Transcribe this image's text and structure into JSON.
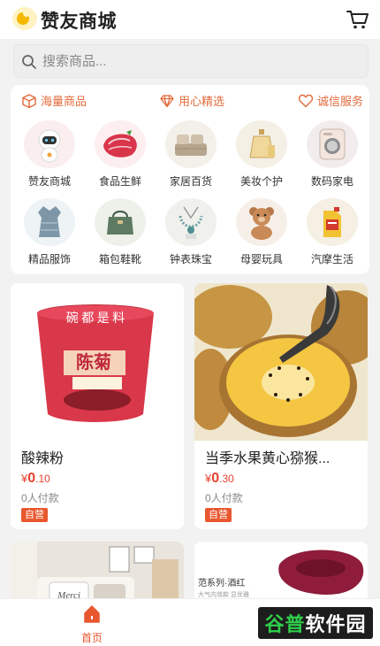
{
  "header": {
    "title": "赞友商城",
    "logo_icon": "banana-logo-icon",
    "cart_icon": "cart-icon"
  },
  "search": {
    "placeholder": "搜索商品..."
  },
  "features": [
    {
      "label": "海量商品",
      "icon": "box-icon"
    },
    {
      "label": "用心精选",
      "icon": "diamond-icon"
    },
    {
      "label": "诚信服务",
      "icon": "heart-icon"
    }
  ],
  "categories": [
    {
      "label": "赞友商城",
      "icon": "robot-icon"
    },
    {
      "label": "食品生鲜",
      "icon": "meat-icon"
    },
    {
      "label": "家居百货",
      "icon": "bedding-icon"
    },
    {
      "label": "美妆个护",
      "icon": "perfume-icon"
    },
    {
      "label": "数码家电",
      "icon": "washer-icon"
    },
    {
      "label": "精品服饰",
      "icon": "dress-icon"
    },
    {
      "label": "箱包鞋靴",
      "icon": "handbag-icon"
    },
    {
      "label": "钟表珠宝",
      "icon": "necklace-icon"
    },
    {
      "label": "母婴玩具",
      "icon": "teddy-bear-icon"
    },
    {
      "label": "汽摩生活",
      "icon": "motor-oil-icon"
    }
  ],
  "products": [
    {
      "name": "酸辣粉",
      "price_symbol": "¥",
      "price_int": "0",
      "price_dec": ".10",
      "sold": "0人付款",
      "badge": "自营",
      "image": "noodle-cup-image",
      "cup_text": "陈菊",
      "cup_top": "碗 都 是 料"
    },
    {
      "name": "当季水果黄心猕猴...",
      "price_symbol": "¥",
      "price_int": "0",
      "price_dec": ".30",
      "sold": "0人付款",
      "badge": "自营",
      "image": "kiwi-fruit-image"
    }
  ],
  "lower_products": [
    {
      "image": "home-decor-image",
      "pillow_text": "Merci"
    },
    {
      "image": "scarf-image",
      "caption": "范系列·酒红",
      "sub_caption": "大气内敛款 显优雅"
    }
  ],
  "tabbar": {
    "home_label": "首页",
    "home_icon": "home-icon"
  },
  "watermark": {
    "text_green": "谷普",
    "text_white": "软件园"
  },
  "colors": {
    "accent": "#e8572e",
    "price": "#e8422e",
    "feature": "#e36b3b"
  }
}
